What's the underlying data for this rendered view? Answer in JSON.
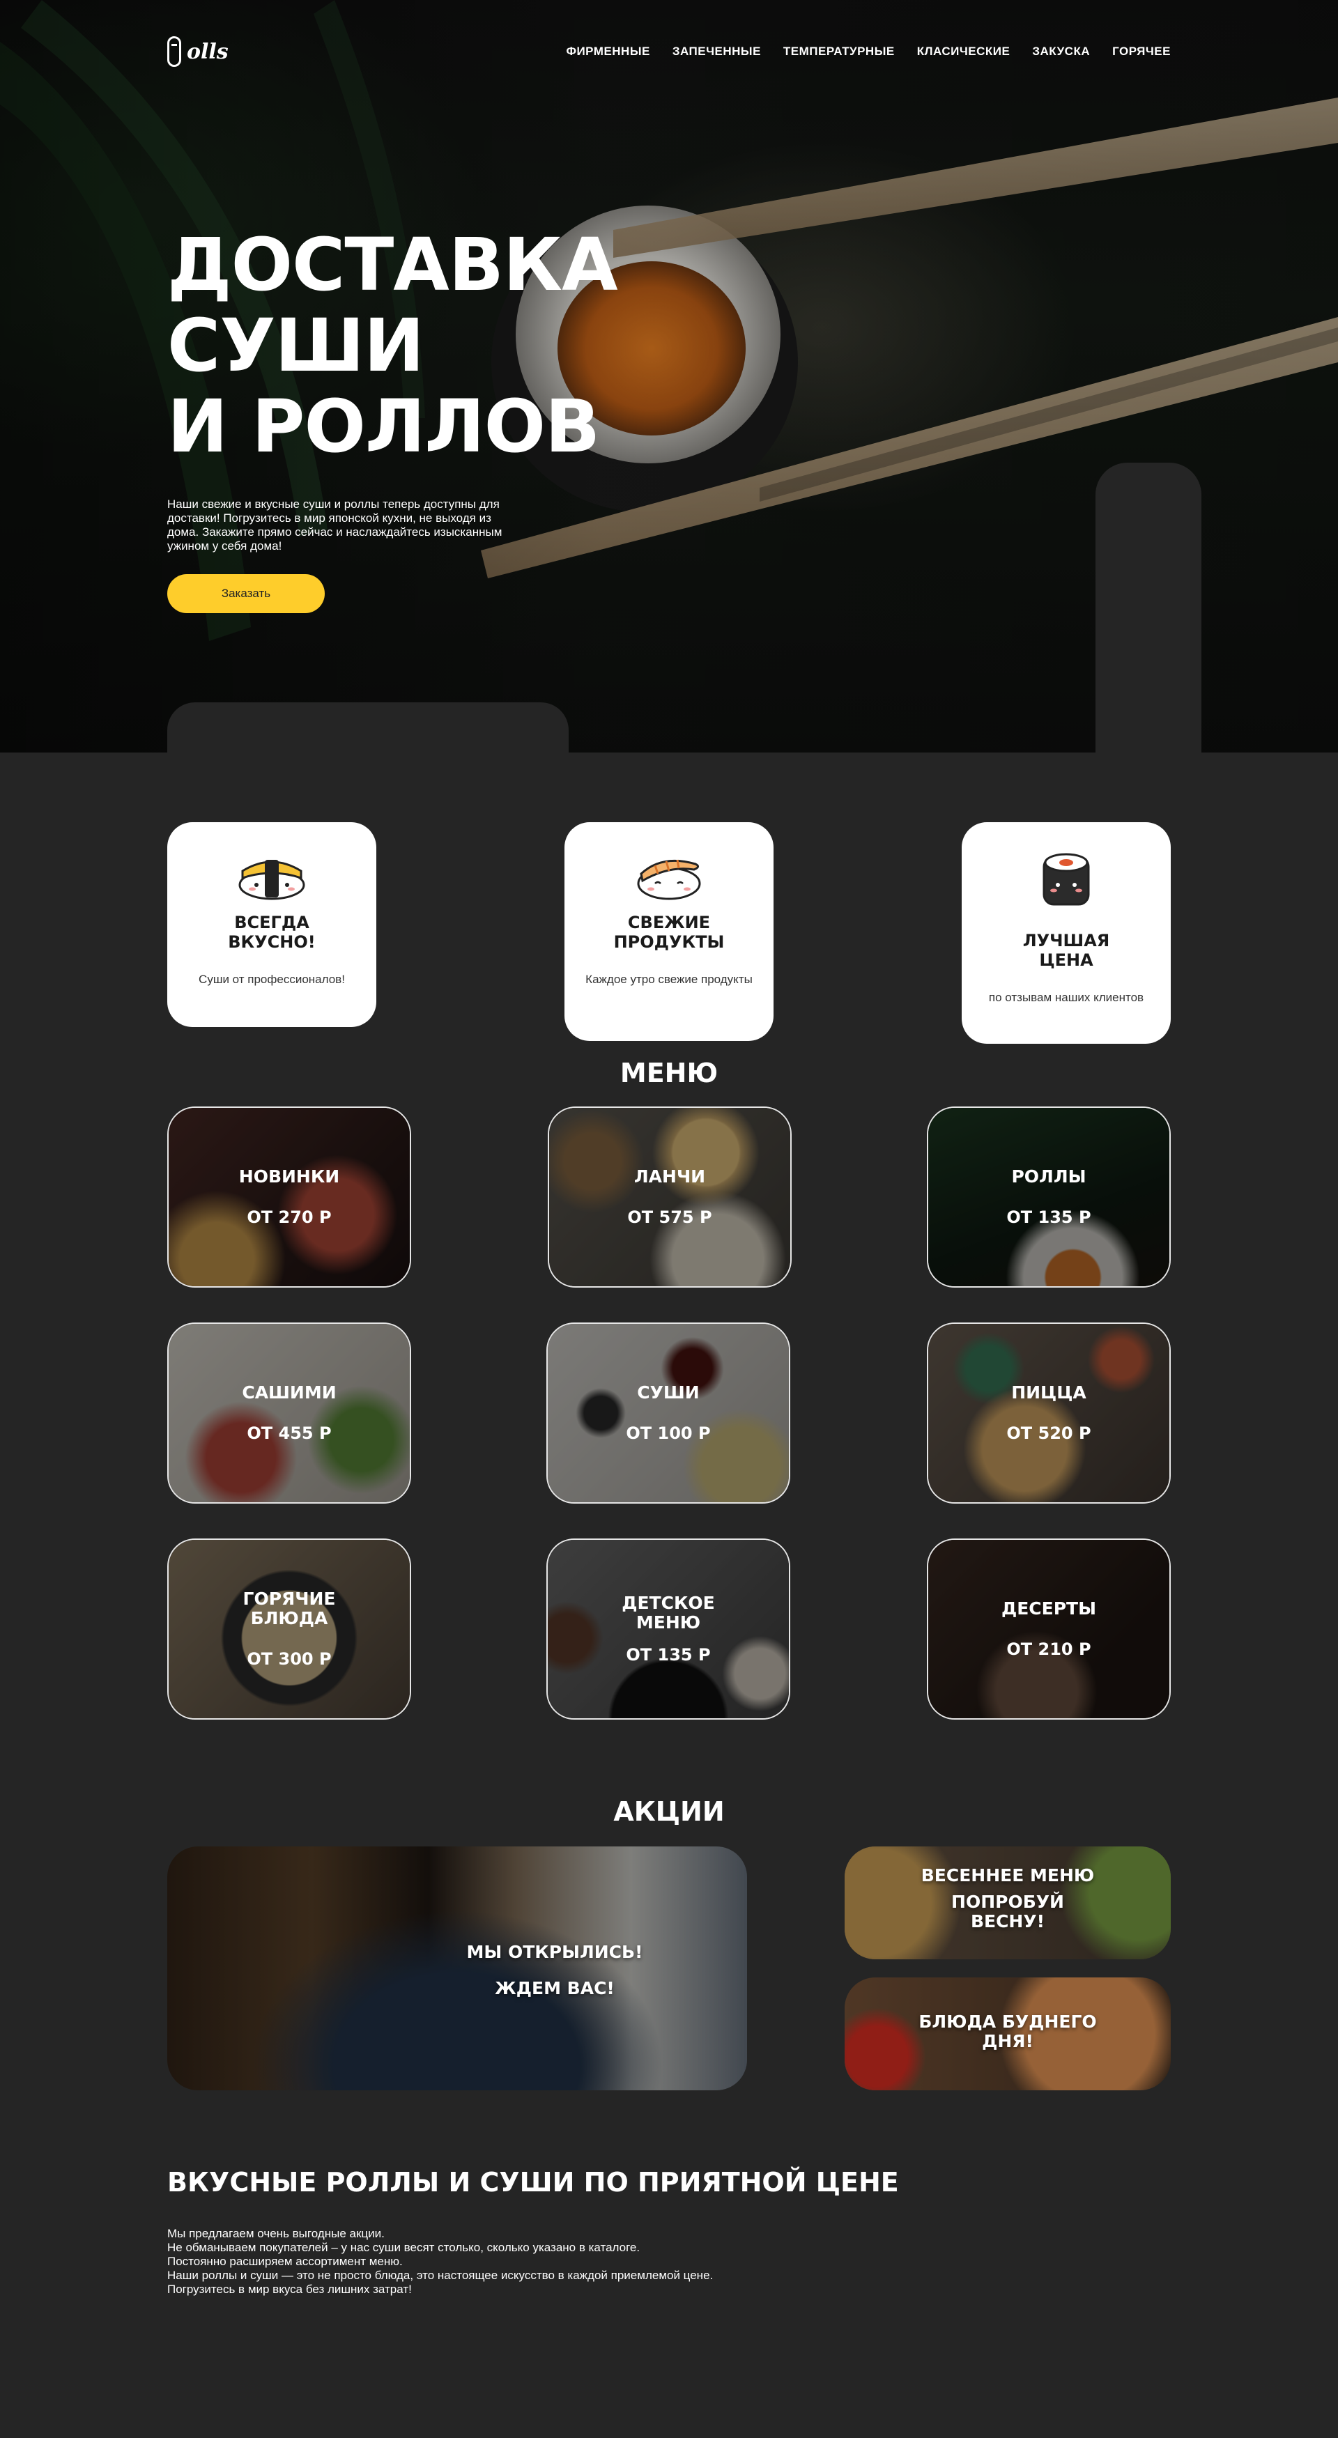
{
  "brand": {
    "logo_text": "olls"
  },
  "nav": {
    "items": [
      "ФИРМЕННЫЕ",
      "ЗАПЕЧЕННЫЕ",
      "ТЕМПЕРАТУРНЫЕ",
      "КЛАСИЧЕСКИЕ",
      "ЗАКУСКА",
      "ГОРЯЧЕЕ"
    ]
  },
  "hero": {
    "title_line1": "ДОСТАВКА СУШИ",
    "title_line2": "И РОЛЛОВ",
    "text": "Наши свежие и вкусные суши и роллы теперь доступны для доставки! Погрузитесь в мир японской кухни, не выходя из дома. Закажите прямо сейчас и наслаждайтесь изысканным ужином у себя дома!",
    "order_label": "Заказать"
  },
  "features": [
    {
      "title_line1": "ВСЕГДА",
      "title_line2": "ВКУСНО!",
      "text": "Суши от профессионалов!",
      "icon": "tamago-sushi-icon"
    },
    {
      "title_line1": "СВЕЖИЕ",
      "title_line2": "ПРОДУКТЫ",
      "text": "Каждое утро свежие продукты",
      "icon": "shrimp-sushi-icon"
    },
    {
      "title_line1": "ЛУЧШАЯ",
      "title_line2": "ЦЕНА",
      "text": "по отзывам наших клиентов",
      "icon": "maki-roll-icon"
    }
  ],
  "menu": {
    "title": "МЕНЮ",
    "items": [
      {
        "name_line1": "НОВИНКИ",
        "name_line2": "",
        "price": "ОТ 270 Р"
      },
      {
        "name_line1": "ЛАНЧИ",
        "name_line2": "",
        "price": "ОТ 575 Р"
      },
      {
        "name_line1": "РОЛЛЫ",
        "name_line2": "",
        "price": "ОТ 135 Р"
      },
      {
        "name_line1": "САШИМИ",
        "name_line2": "",
        "price": "ОТ 455 Р"
      },
      {
        "name_line1": "СУШИ",
        "name_line2": "",
        "price": "ОТ 100 Р"
      },
      {
        "name_line1": "ПИЦЦА",
        "name_line2": "",
        "price": "ОТ 520 Р"
      },
      {
        "name_line1": "ГОРЯЧИЕ",
        "name_line2": "БЛЮДА",
        "price": "ОТ 300 Р"
      },
      {
        "name_line1": "ДЕТСКОЕ",
        "name_line2": "МЕНЮ",
        "price": "ОТ 135 Р"
      },
      {
        "name_line1": "ДЕСЕРТЫ",
        "name_line2": "",
        "price": "ОТ 210 Р"
      }
    ]
  },
  "promos": {
    "title": "АКЦИИ",
    "main": {
      "line1": "МЫ ОТКРЫЛИСЬ!",
      "line2": "ЖДЕМ ВАС!"
    },
    "spring": {
      "line1": "ВЕСЕННЕЕ МЕНЮ",
      "line2": "ПОПРОБУЙ",
      "line3": "ВЕСНУ!"
    },
    "weekday": {
      "line1": "БЛЮДА БУДНЕГО",
      "line2": "ДНЯ!"
    }
  },
  "about": {
    "title": "ВКУСНЫЕ РОЛЛЫ И СУШИ ПО ПРИЯТНОЙ ЦЕНЕ",
    "lines": [
      "Мы предлагаем очень выгодные акции.",
      "Не обманываем покупателей – у нас суши весят столько, сколько указано в каталоге.",
      "Постоянно расширяем ассортимент меню.",
      "Наши роллы и суши — это не просто блюда, это настоящее искусство в каждой приемлемой цене.",
      "Погрузитесь в мир вкуса без лишних затрат!"
    ]
  },
  "colors": {
    "accent": "#fecd2b",
    "page_bg": "#252525",
    "card_bg": "#ffffff"
  }
}
